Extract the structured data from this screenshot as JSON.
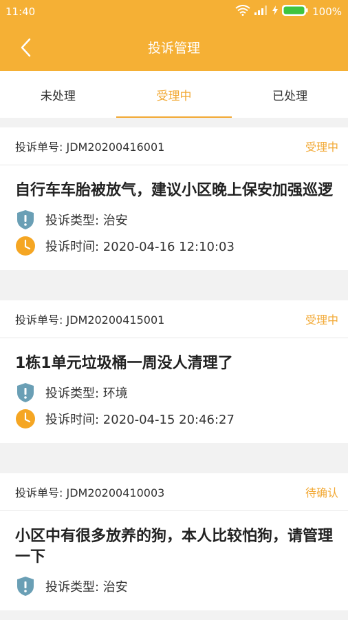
{
  "status_bar": {
    "time": "11:40",
    "battery": "100%"
  },
  "header": {
    "title": "投诉管理"
  },
  "tabs": [
    {
      "label": "未处理"
    },
    {
      "label": "受理中"
    },
    {
      "label": "已处理"
    }
  ],
  "complaints": [
    {
      "order_no": "投诉单号: JDM20200416001",
      "status": "受理中",
      "title": "自行车车胎被放气，建议小区晚上保安加强巡逻",
      "type": "投诉类型: 治安",
      "time": "投诉时间: 2020-04-16 12:10:03"
    },
    {
      "order_no": "投诉单号: JDM20200415001",
      "status": "受理中",
      "title": "1栋1单元垃圾桶一周没人清理了",
      "type": "投诉类型: 环境",
      "time": "投诉时间: 2020-04-15 20:46:27"
    },
    {
      "order_no": "投诉单号: JDM20200410003",
      "status": "待确认",
      "title": "小区中有很多放养的狗，本人比较怕狗，请管理一下",
      "type": "投诉类型: 治安"
    }
  ],
  "colors": {
    "accent": "#f5b035",
    "shield": "#6a9fb5",
    "clock": "#f5a623"
  }
}
